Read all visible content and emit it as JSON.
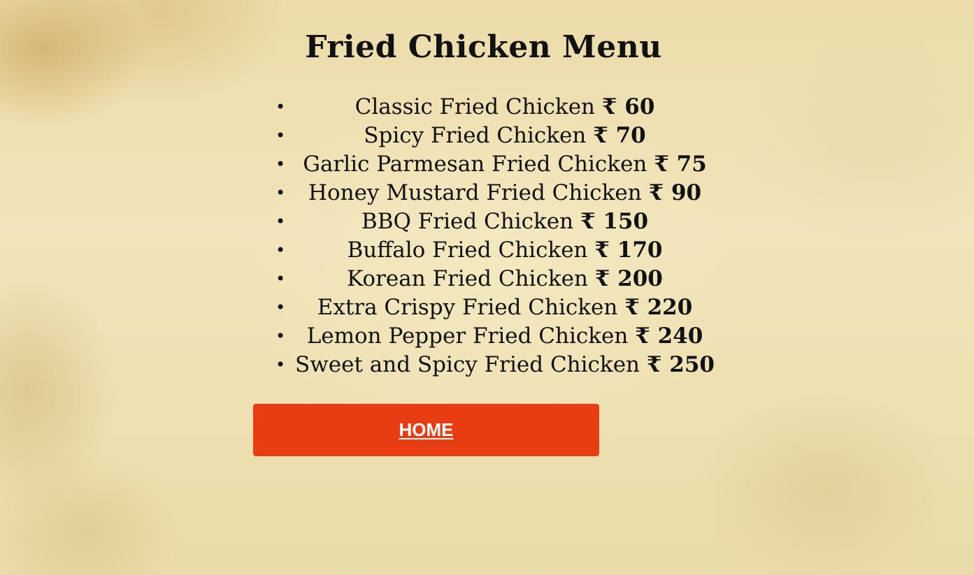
{
  "title": "Fried Chicken Menu",
  "currency_symbol": "₹",
  "menu": {
    "items": [
      {
        "name": "Classic Fried Chicken",
        "price": "60"
      },
      {
        "name": "Spicy Fried Chicken",
        "price": "70"
      },
      {
        "name": "Garlic Parmesan Fried Chicken",
        "price": "75"
      },
      {
        "name": "Honey Mustard Fried Chicken",
        "price": "90"
      },
      {
        "name": "BBQ Fried Chicken",
        "price": "150"
      },
      {
        "name": "Buffalo Fried Chicken",
        "price": "170"
      },
      {
        "name": "Korean Fried Chicken",
        "price": "200"
      },
      {
        "name": "Extra Crispy Fried Chicken",
        "price": "220"
      },
      {
        "name": "Lemon Pepper Fried Chicken",
        "price": "240"
      },
      {
        "name": "Sweet and Spicy Fried Chicken",
        "price": "250"
      }
    ]
  },
  "home_button": {
    "label": "HOME",
    "color": "#e83d12",
    "text_color": "#ffffff"
  },
  "background": {
    "style": "aged parchment texture",
    "base_color": "#efe1b3"
  }
}
